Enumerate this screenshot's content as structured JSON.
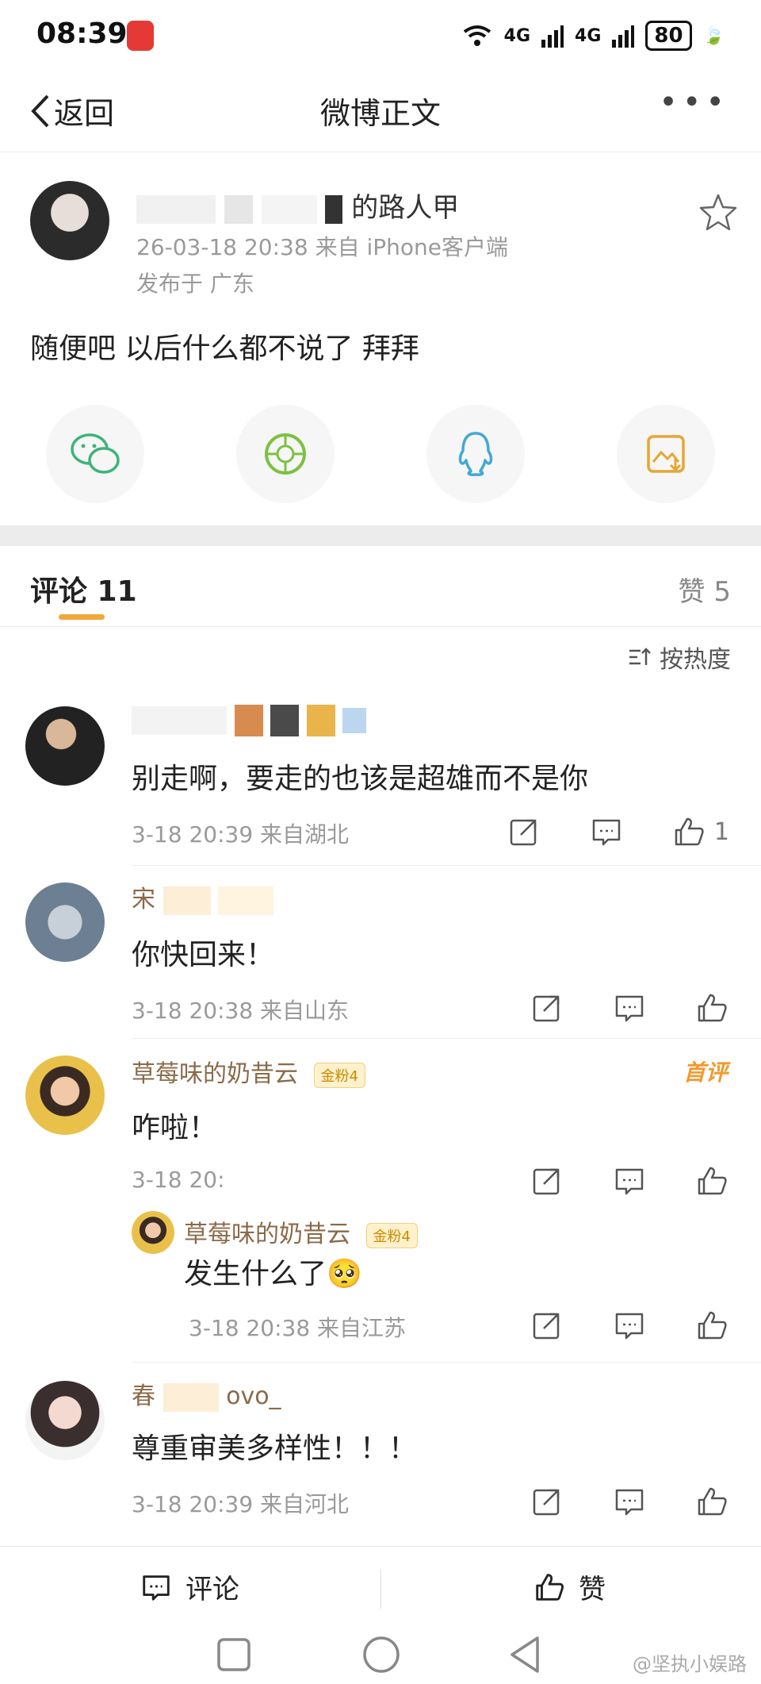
{
  "status": {
    "time": "08:39",
    "signal1": "4G",
    "signal2": "4G",
    "battery": "80"
  },
  "nav": {
    "back_label": "返回",
    "title": "微博正文",
    "more": "•••"
  },
  "post": {
    "author_partial": "的路人甲",
    "meta": "26-03-18 20:38  来自 iPhone客户端",
    "location": "发布于 广东",
    "text": "随便吧 以后什么都不说了 拜拜"
  },
  "share": [
    "wechat-icon",
    "moments-icon",
    "qq-icon",
    "save-image-icon"
  ],
  "comments_header": {
    "tab_label": "评论 11",
    "likes_label": "赞 5",
    "sort_label": "按热度"
  },
  "comments": [
    {
      "name": "",
      "text": "别走啊，要走的也该是超雄而不是你",
      "meta": "3-18 20:39  来自湖北",
      "likes": "1"
    },
    {
      "name": "宋",
      "text": "你快回来！",
      "meta": "3-18 20:38  来自山东",
      "likes": ""
    },
    {
      "name": "草莓味的奶昔云",
      "badge": "金粉4",
      "tag": "首评",
      "text": "咋啦！",
      "meta": "3-18 20:",
      "likes": ""
    },
    {
      "name": "草莓味的奶昔云",
      "badge": "金粉4",
      "text": "发生什么了🥺",
      "meta": "3-18 20:38  来自江苏",
      "likes": ""
    },
    {
      "name": "春",
      "name_suffix": "ovo_",
      "text": "尊重审美多样性！！！",
      "meta": "3-18 20:39  来自河北",
      "likes": ""
    }
  ],
  "bottom": {
    "comment_label": "评论",
    "like_label": "赞"
  },
  "watermark": "@坚执小娱路"
}
